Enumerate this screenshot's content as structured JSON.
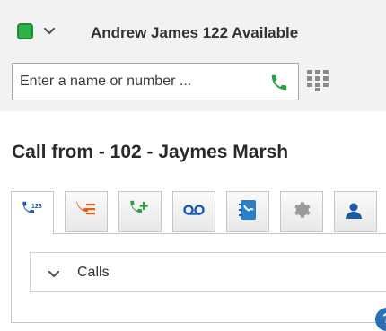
{
  "status": {
    "indicator_color": "#2fb24a",
    "indicator_icon": "status-green-icon",
    "chevron_icon": "chevron-down-icon",
    "text": "Andrew James 122 Available"
  },
  "dial": {
    "placeholder": "Enter a name or number ...",
    "call_icon": "phone-icon",
    "dialpad_icon": "dialpad-icon",
    "call_icon_color": "#2e9e3e"
  },
  "call": {
    "title": "Call from - 102 - Jaymes Marsh"
  },
  "tabs": [
    {
      "icon": "dialpad-123-icon",
      "active": true
    },
    {
      "icon": "call-history-icon",
      "active": false
    },
    {
      "icon": "add-call-icon",
      "active": false
    },
    {
      "icon": "voicemail-icon",
      "active": false
    },
    {
      "icon": "contacts-icon",
      "active": false
    },
    {
      "icon": "settings-icon",
      "active": false
    },
    {
      "icon": "user-icon",
      "active": false
    }
  ],
  "calls_section": {
    "label": "Calls",
    "chevron_icon": "chevron-down-icon"
  },
  "help": {
    "icon": "help-icon",
    "label": "?"
  }
}
